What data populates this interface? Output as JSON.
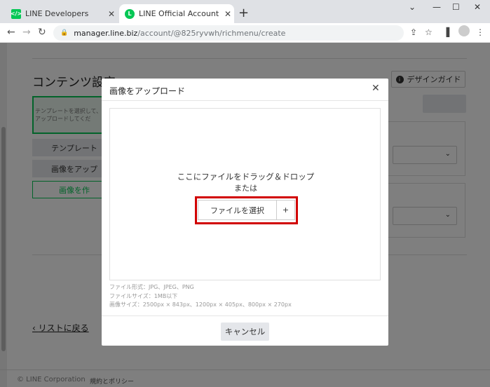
{
  "browser": {
    "tabs": [
      {
        "title": "LINE Developers",
        "favicon_color": "#06c755",
        "active": false
      },
      {
        "title": "LINE Official Account Manager",
        "favicon_color": "#06c755",
        "active": true
      }
    ],
    "new_tab_icon": "plus-icon",
    "url_host": "manager.line.biz",
    "url_path": "/account/@825ryvwh/richmenu/create"
  },
  "page": {
    "section_title": "コンテンツ設定",
    "design_guide_label": "デザインガイド",
    "template_box_text": "テンプレートを選択して、A\nをアップロードしてくだ",
    "template_button": "テンプレート",
    "upload_button": "画像をアップ",
    "create_button": "画像を作",
    "back_link": "リストに戻る",
    "footer_copy": "© LINE Corporation",
    "footer_policy": "規約とポリシー"
  },
  "modal": {
    "title": "画像をアップロード",
    "drop_line1": "ここにファイルをドラッグ＆ドロップ",
    "drop_line2": "または",
    "choose_file_label": "ファイルを選択",
    "plus_label": "+",
    "note_format": "ファイル形式：JPG、JPEG、PNG",
    "note_size": "ファイルサイズ：1MB以下",
    "note_dimensions": "画像サイズ：2500px × 843px、1200px × 405px、800px × 270px",
    "cancel_label": "キャンセル"
  },
  "colors": {
    "line_green": "#06c755",
    "highlight_red": "#d10000"
  }
}
